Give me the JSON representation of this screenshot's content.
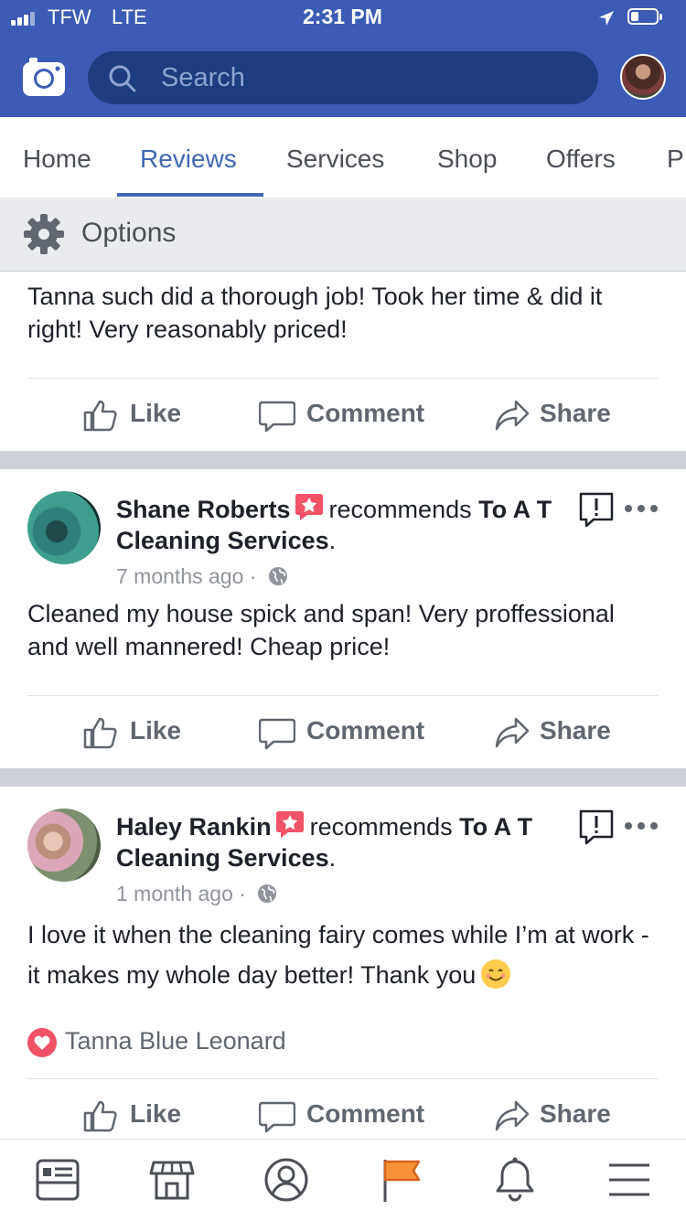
{
  "status_bar": {
    "carrier": "TFW",
    "network": "LTE",
    "time": "2:31 PM",
    "battery_level": 0.3
  },
  "header": {
    "search_placeholder": "Search",
    "brand_color": "#3b5bb5"
  },
  "tabs": [
    {
      "label": "Home",
      "active": false
    },
    {
      "label": "Reviews",
      "active": true
    },
    {
      "label": "Services",
      "active": false
    },
    {
      "label": "Shop",
      "active": false
    },
    {
      "label": "Offers",
      "active": false
    },
    {
      "label": "P",
      "active": false
    }
  ],
  "options": {
    "label": "Options",
    "icon": "gear-icon"
  },
  "actions": {
    "like": "Like",
    "comment": "Comment",
    "share": "Share"
  },
  "posts": [
    {
      "text": "Tanna such did a thorough job! Took her time & did it right! Very reasonably priced!"
    },
    {
      "author": "Shane Roberts",
      "verb": "recommends",
      "page": "To A T Cleaning Services",
      "time": "7 months ago",
      "text": "Cleaned my house spick and span! Very proffessional and well mannered! Cheap price!"
    },
    {
      "author": "Haley Rankin",
      "verb": "recommends",
      "page": "To A T Cleaning Services",
      "time": "1 month ago",
      "text": "I love it when the cleaning fairy comes while I’m at work - it makes my whole day better! Thank you",
      "reaction": {
        "type": "love",
        "name": "Tanna Blue Leonard",
        "color": "#f25268"
      }
    }
  ],
  "bottom_nav": [
    {
      "icon": "news-feed-icon",
      "active": false
    },
    {
      "icon": "marketplace-icon",
      "active": false
    },
    {
      "icon": "profile-icon",
      "active": false
    },
    {
      "icon": "pages-flag-icon",
      "active": true,
      "color": "#f7923a"
    },
    {
      "icon": "notifications-bell-icon",
      "active": false
    },
    {
      "icon": "menu-icon",
      "active": false
    }
  ]
}
